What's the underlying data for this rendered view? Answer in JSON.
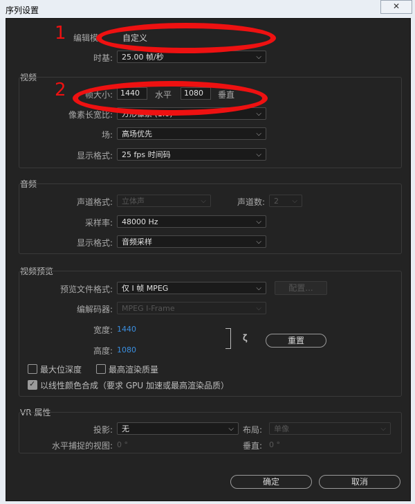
{
  "window": {
    "title": "序列设置",
    "close_glyph": "✕"
  },
  "annotations": {
    "n1": "1",
    "n2": "2",
    "color": "#ee1111"
  },
  "top": {
    "editing_mode_label": "编辑模",
    "editing_mode_value": "自定义",
    "timebase_label": "时基:",
    "timebase_value": "25.00  帧/秒"
  },
  "video": {
    "section": "视频",
    "frame_size_label": "帧大小:",
    "frame_width": "1440",
    "horizontal_label": "水平",
    "frame_height": "1080",
    "vertical_label": "垂直",
    "pixel_aspect_label": "像素长宽比:",
    "pixel_aspect_value": "方形像素 (1.0)",
    "fields_label": "场:",
    "fields_value": "高场优先",
    "display_format_label": "显示格式:",
    "display_format_value": "25 fps 时间码"
  },
  "audio": {
    "section": "音频",
    "channel_format_label": "声道格式:",
    "channel_format_value": "立体声",
    "channel_count_label": "声道数:",
    "channel_count_value": "2",
    "sample_rate_label": "采样率:",
    "sample_rate_value": "48000 Hz",
    "display_format_label": "显示格式:",
    "display_format_value": "音频采样"
  },
  "preview": {
    "section": "视频预览",
    "file_format_label": "预览文件格式:",
    "file_format_value": "仅 I 帧 MPEG",
    "configure_button": "配置...",
    "codec_label": "编解码器:",
    "codec_value": "MPEG I-Frame",
    "width_label": "宽度:",
    "width_value": "1440",
    "height_label": "高度:",
    "height_value": "1080",
    "reset_button": "重置",
    "max_bit_depth_label": "最大位深度",
    "max_render_quality_label": "最高渲染质量",
    "linear_color_label": "以线性颜色合成（要求 GPU 加速或最高渲染品质）",
    "max_bit_depth_checked": false,
    "max_render_quality_checked": false,
    "linear_color_checked": true
  },
  "vr": {
    "section": "VR 属性",
    "projection_label": "投影:",
    "projection_value": "无",
    "layout_label": "布局:",
    "layout_value": "单像",
    "h_view_label": "水平捕捉的视图:",
    "h_view_value": "0 °",
    "v_view_label": "垂直:",
    "v_view_value": "0 °"
  },
  "footer": {
    "ok_button": "确定",
    "cancel_button": "取消"
  }
}
